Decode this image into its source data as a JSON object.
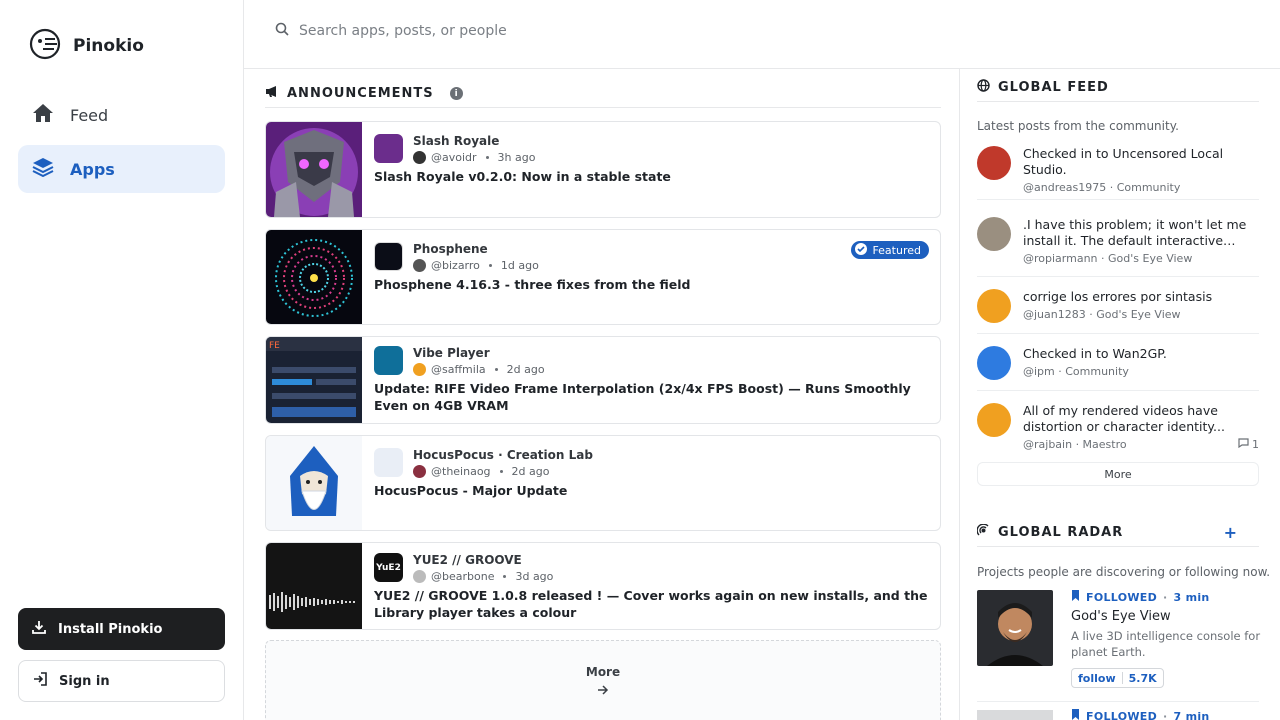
{
  "brand": {
    "name": "Pinokio"
  },
  "nav": [
    {
      "label": "Feed",
      "icon": "home-icon"
    },
    {
      "label": "Apps",
      "icon": "layers-icon"
    }
  ],
  "sidebar_buttons": {
    "install": "Install Pinokio",
    "signin": "Sign in"
  },
  "search": {
    "placeholder": "Search apps, posts, or people"
  },
  "announcements": {
    "heading": "ANNOUNCEMENTS",
    "info": "i",
    "items": [
      {
        "app": "Slash Royale",
        "user": "@avoidr",
        "time": "3h ago",
        "title": "Slash Royale v0.2.0: Now in a stable state"
      },
      {
        "app": "Phosphene",
        "user": "@bizarro",
        "time": "1d ago",
        "title": "Phosphene 4.16.3 - three fixes from the field",
        "badge": "Featured"
      },
      {
        "app": "Vibe Player",
        "user": "@saffmila",
        "time": "2d ago",
        "title": "Update: RIFE Video Frame Interpolation (2x/4x FPS Boost) — Runs Smoothly Even on 4GB VRAM"
      },
      {
        "app": "HocusPocus · Creation Lab",
        "user": "@theinaog",
        "time": "2d ago",
        "title": "HocusPocus - Major Update"
      },
      {
        "app": "YUE2 // GROOVE",
        "user": "@bearbone",
        "time": "3d ago",
        "title": "YUE2 // GROOVE 1.0.8 released ! — Cover works again on new installs, and the Library player takes a colour",
        "icon_text": "YuE2"
      }
    ],
    "more": "More"
  },
  "global_feed": {
    "heading": "GLOBAL FEED",
    "subtitle": "Latest posts from the community.",
    "items": [
      {
        "text": "Checked in to Uncensored Local Studio.",
        "by": "@andreas1975 · Community"
      },
      {
        "text": ".I have this problem; it won't let me install it. The default interactive shel...",
        "by": "@ropiarmann · God's Eye View"
      },
      {
        "text": "corrige los errores por sintasis",
        "by": "@juan1283 · God's Eye View"
      },
      {
        "text": "Checked in to Wan2GP.",
        "by": "@ipm · Community"
      },
      {
        "text": "All of my rendered videos have distortion or character identity...",
        "by": "@rajbain · Maestro",
        "comments": "1"
      }
    ],
    "more": "More"
  },
  "global_radar": {
    "heading": "GLOBAL RADAR",
    "plus": "+",
    "subtitle": "Projects people are discovering or following now.",
    "items": [
      {
        "status": "FOLLOWED",
        "time": "3 min",
        "title": "God's Eye View",
        "desc": "A live 3D intelligence console for planet Earth.",
        "follow": "follow",
        "count": "5.7K"
      },
      {
        "status": "FOLLOWED",
        "time": "7 min"
      }
    ]
  }
}
